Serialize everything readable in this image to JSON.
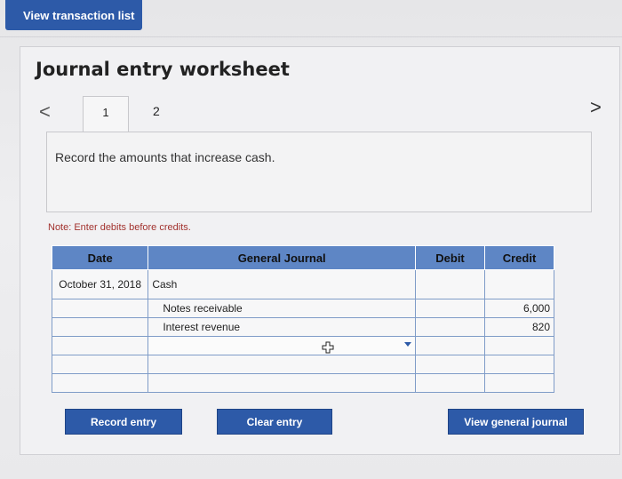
{
  "header": {
    "view_transactions_label": "View transaction list"
  },
  "worksheet": {
    "title": "Journal entry worksheet",
    "tabs": [
      "1",
      "2"
    ],
    "prev_glyph": "<",
    "next_glyph": ">",
    "instruction": "Record the amounts that increase cash.",
    "note_label": "Note: Enter debits before credits."
  },
  "table": {
    "headers": {
      "date": "Date",
      "general_journal": "General Journal",
      "debit": "Debit",
      "credit": "Credit"
    },
    "rows": [
      {
        "date": "October 31, 2018",
        "account": "Cash",
        "debit": "",
        "credit": ""
      },
      {
        "date": "",
        "account": "Notes receivable",
        "debit": "",
        "credit": "6,000"
      },
      {
        "date": "",
        "account": "Interest revenue",
        "debit": "",
        "credit": "820"
      },
      {
        "date": "",
        "account": "",
        "debit": "",
        "credit": ""
      },
      {
        "date": "",
        "account": "",
        "debit": "",
        "credit": ""
      },
      {
        "date": "",
        "account": "",
        "debit": "",
        "credit": ""
      }
    ]
  },
  "buttons": {
    "record": "Record entry",
    "clear": "Clear entry",
    "view_journal": "View general journal"
  },
  "colors": {
    "primary": "#2d5aa8",
    "header_bg": "#5e86c5",
    "note_red": "#a2322e"
  }
}
